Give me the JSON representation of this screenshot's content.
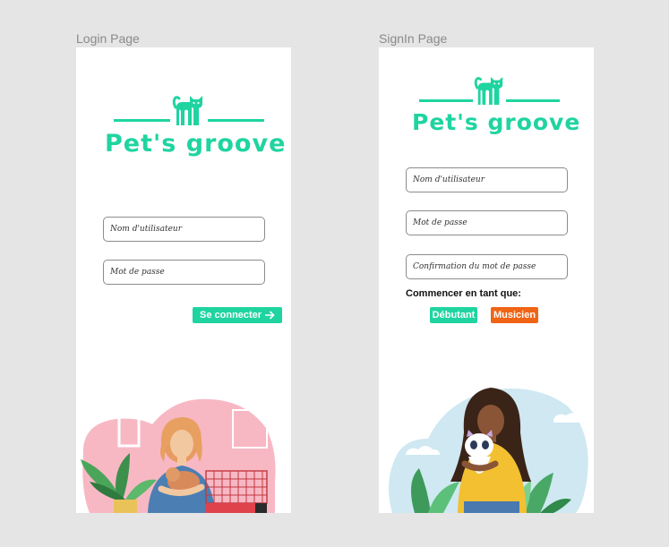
{
  "login": {
    "frame_label": "Login Page",
    "brand": "Pet's groove",
    "username_placeholder": "Nom d'utilisateur",
    "password_placeholder": "Mot de passe",
    "submit_label": "Se connecter"
  },
  "signin": {
    "frame_label": "SignIn Page",
    "brand": "Pet's groove",
    "username_placeholder": "Nom d'utilisateur",
    "password_placeholder": "Mot de passe",
    "confirm_placeholder": "Confirmation du mot de passe",
    "start_as_label": "Commencer en tant que:",
    "role_options": [
      "Débutant",
      "Musicien"
    ]
  },
  "colors": {
    "brand": "#1fd4a0",
    "musician": "#f06415"
  },
  "icons": [
    "cat-logo-icon",
    "arrow-right-icon"
  ]
}
